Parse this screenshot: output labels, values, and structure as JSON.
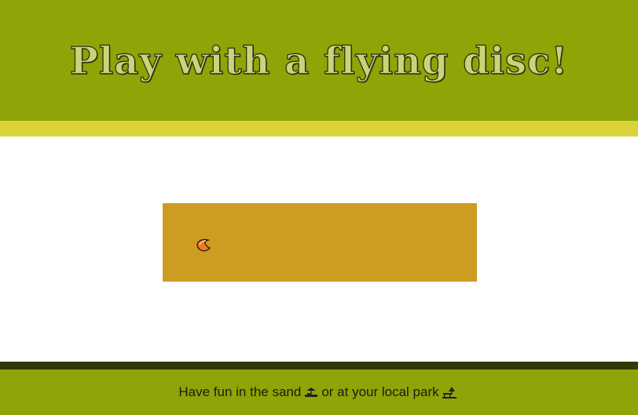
{
  "header": {
    "title": "Play with a flying disc!"
  },
  "game": {
    "disc_icon": "flying-disc-icon"
  },
  "footer": {
    "text_before": "Have fun in the sand",
    "sand_icon": "beach-icon",
    "text_middle": "or at your local park",
    "park_icon": "park-icon"
  },
  "colors": {
    "header_bg": "#8fa406",
    "accent_stripe": "#dcd33a",
    "play_field": "#cd9d22",
    "footer_stripe": "#2f3a06",
    "footer_bg": "#8fa406"
  }
}
